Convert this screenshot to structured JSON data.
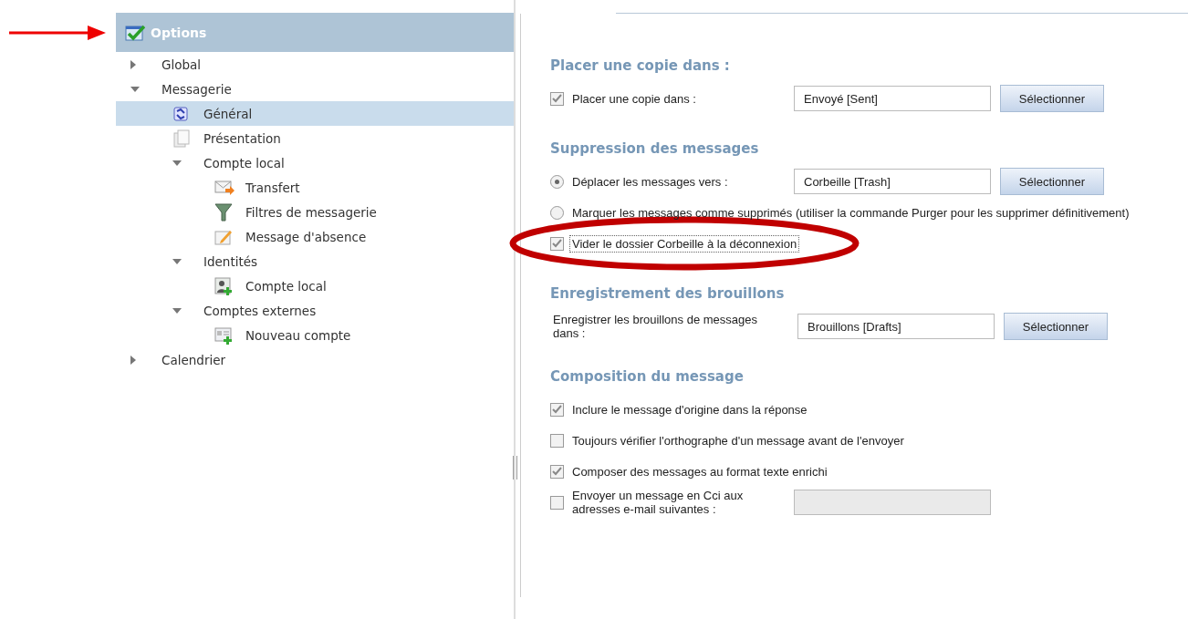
{
  "sidebar": {
    "title": "Options",
    "items": [
      {
        "label": "Global",
        "expanded": false,
        "selected": false
      },
      {
        "label": "Messagerie",
        "expanded": true,
        "selected": false,
        "children": [
          {
            "label": "Général",
            "kind": "general",
            "selected": true
          },
          {
            "label": "Présentation",
            "kind": "page",
            "selected": false
          },
          {
            "label": "Compte local",
            "expanded": true,
            "selected": false,
            "children": [
              {
                "label": "Transfert",
                "kind": "forward",
                "selected": false
              },
              {
                "label": "Filtres de messagerie",
                "kind": "filter",
                "selected": false
              },
              {
                "label": "Message d'absence",
                "kind": "away",
                "selected": false
              }
            ]
          },
          {
            "label": "Identités",
            "expanded": true,
            "selected": false,
            "children": [
              {
                "label": "Compte local",
                "kind": "identity",
                "selected": false
              }
            ]
          },
          {
            "label": "Comptes externes",
            "expanded": true,
            "selected": false,
            "children": [
              {
                "label": "Nouveau compte",
                "kind": "account",
                "selected": false
              }
            ]
          }
        ]
      },
      {
        "label": "Calendrier",
        "expanded": false,
        "selected": false
      }
    ]
  },
  "sections": [
    {
      "heading": "Placer une copie dans :",
      "rows": [
        {
          "kind": "checkfield",
          "label": "Placer une copie dans :",
          "checked": true,
          "value": "Envoyé [Sent]",
          "button": "Sélectionner"
        }
      ]
    },
    {
      "heading": "Suppression des messages",
      "rows": [
        {
          "kind": "radiofield",
          "label": "Déplacer les messages vers :",
          "selected": true,
          "value": "Corbeille [Trash]",
          "button": "Sélectionner"
        },
        {
          "kind": "radio",
          "label": "Marquer les messages comme supprimés (utiliser la commande Purger pour les supprimer définitivement)",
          "selected": false
        },
        {
          "kind": "check",
          "label": "Vider le dossier Corbeille à la déconnexion",
          "checked": true,
          "focused": true,
          "circled": true
        }
      ]
    },
    {
      "heading": "Enregistrement des brouillons",
      "rows": [
        {
          "kind": "field",
          "label": "Enregistrer les brouillons de messages dans :",
          "value": "Brouillons [Drafts]",
          "button": "Sélectionner"
        }
      ]
    },
    {
      "heading": "Composition du message",
      "rows": [
        {
          "kind": "check",
          "label": "Inclure le message d'origine dans la réponse",
          "checked": true,
          "focused": false
        },
        {
          "kind": "check",
          "label": "Toujours vérifier l'orthographe d'un message avant de l'envoyer",
          "checked": false,
          "focused": false
        },
        {
          "kind": "check",
          "label": "Composer des messages au format texte enrichi",
          "checked": true,
          "focused": false
        },
        {
          "kind": "checkfield",
          "label": "Envoyer un message en Cci aux adresses e-mail suivantes :",
          "checked": false,
          "disabled": true
        }
      ]
    }
  ]
}
